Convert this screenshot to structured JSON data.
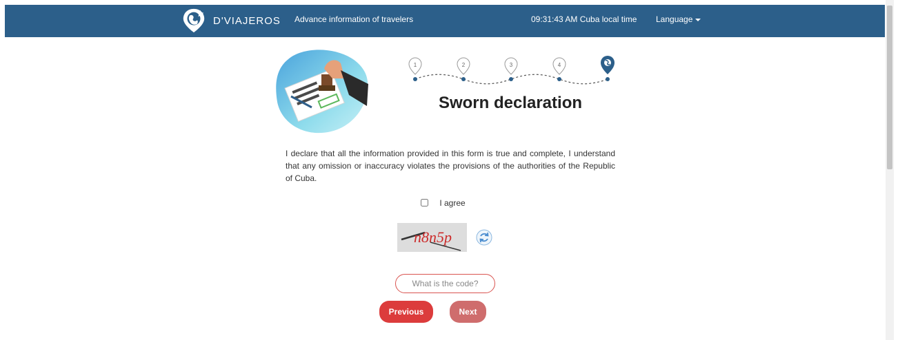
{
  "header": {
    "brand": "D'VIAJEROS",
    "subtitle": "Advance information of travelers",
    "clock": "09:31:43 AM Cuba local time",
    "language_label": "Language",
    "bg_color": "#2c5f8a"
  },
  "steps": {
    "items": [
      "1",
      "2",
      "3",
      "4"
    ],
    "current_icon": "map-pin-icon",
    "active_color": "#2c5f8a"
  },
  "page": {
    "title": "Sworn declaration",
    "declaration": "I declare that all the information provided in this form is true and complete, I understand that any omission or inaccuracy violates the provisions of the authorities of the Republic of Cuba.",
    "agree_label": "I agree"
  },
  "captcha": {
    "text": "n8n5p",
    "refresh_icon": "refresh-icon",
    "placeholder": "What is the code?"
  },
  "buttons": {
    "previous": "Previous",
    "next": "Next",
    "previous_color": "#dc3c3c",
    "next_color": "#cf6d6d"
  }
}
